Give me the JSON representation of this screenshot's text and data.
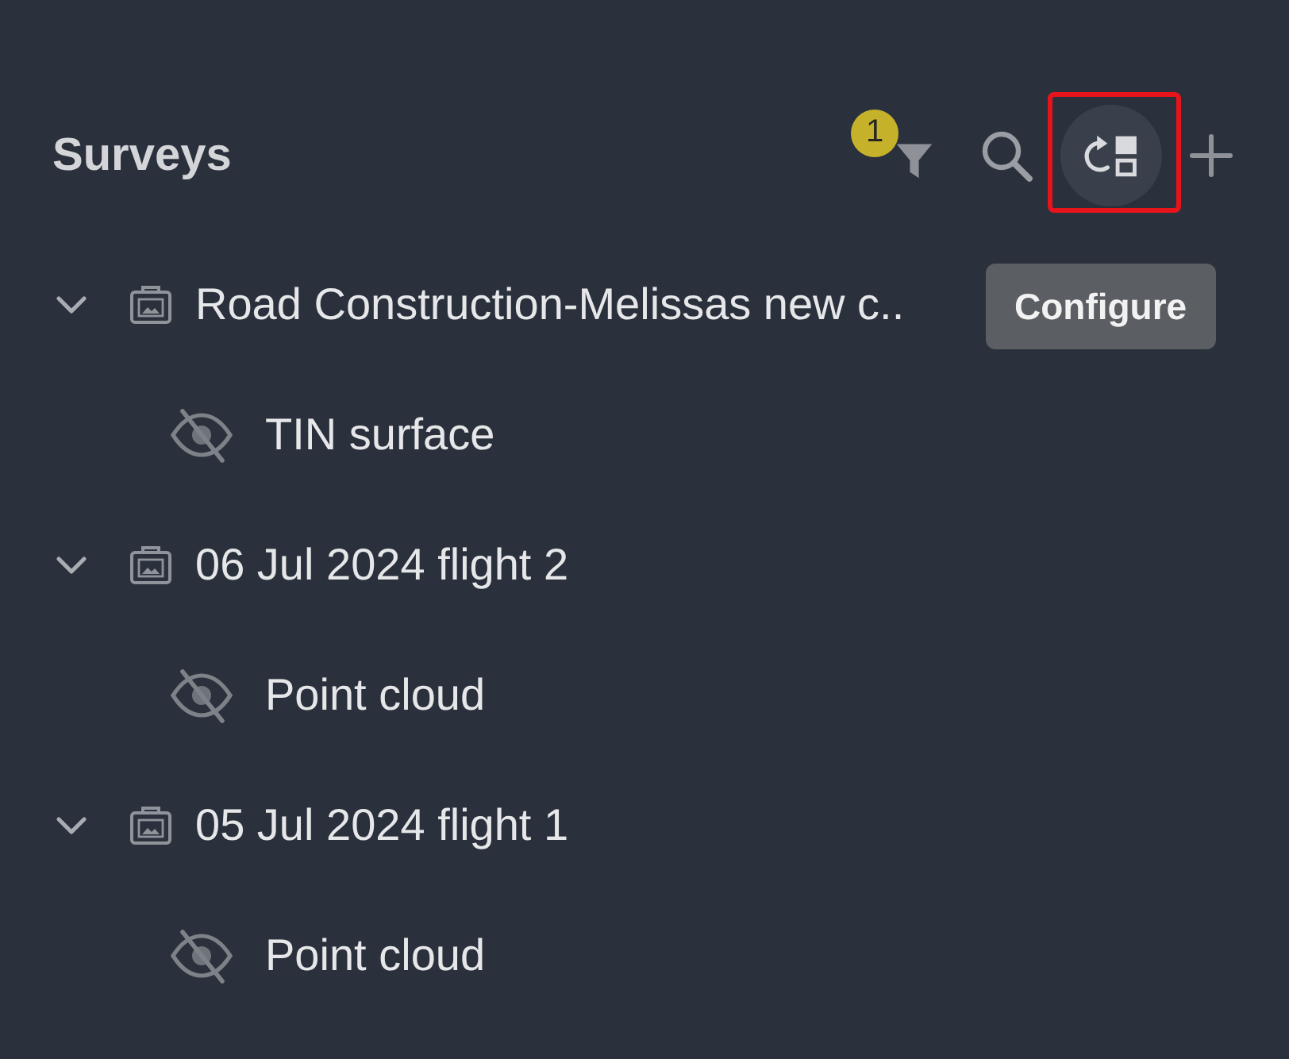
{
  "panel": {
    "title": "Surveys"
  },
  "toolbar": [
    {
      "kind": "filter",
      "badge": "1",
      "hovered": false,
      "highlighted": false
    },
    {
      "kind": "search",
      "hovered": false,
      "highlighted": false
    },
    {
      "kind": "configure",
      "hovered": true,
      "highlighted": true,
      "tooltip": "Configure"
    },
    {
      "kind": "add",
      "hovered": false,
      "highlighted": false
    }
  ],
  "tree": [
    {
      "label": "Road Construction-Melissas new c..",
      "expanded": true,
      "children": [
        {
          "label": "TIN surface",
          "visible": false
        }
      ]
    },
    {
      "label": "06 Jul 2024 flight 2",
      "expanded": true,
      "children": [
        {
          "label": "Point cloud",
          "visible": false
        }
      ]
    },
    {
      "label": "05 Jul 2024 flight 1",
      "expanded": true,
      "children": [
        {
          "label": "Point cloud",
          "visible": false
        }
      ]
    }
  ]
}
